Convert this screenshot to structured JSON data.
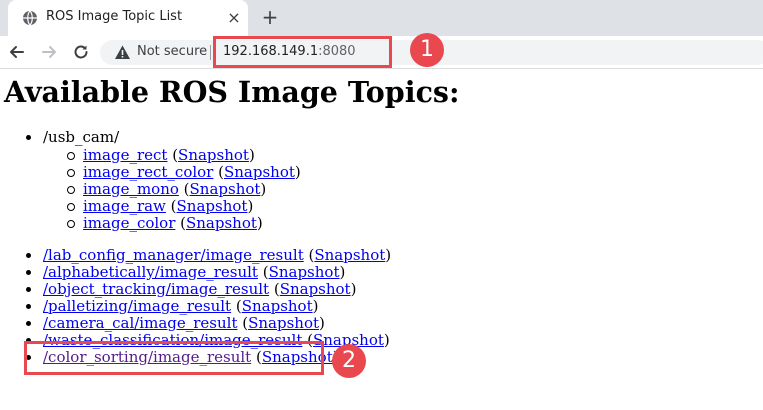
{
  "browser": {
    "tab_title": "ROS Image Topic List",
    "close_glyph": "×",
    "newtab_glyph": "+",
    "security_label": "Not secure",
    "url_host": "192.168.149.1",
    "url_port": ":8080"
  },
  "page": {
    "title": "Available ROS Image Topics:",
    "group": {
      "label": "/usb_cam/",
      "items": [
        {
          "name": "image_rect",
          "snapshot": "Snapshot"
        },
        {
          "name": "image_rect_color",
          "snapshot": "Snapshot"
        },
        {
          "name": "image_mono",
          "snapshot": "Snapshot"
        },
        {
          "name": "image_raw",
          "snapshot": "Snapshot"
        },
        {
          "name": "image_color",
          "snapshot": "Snapshot"
        }
      ]
    },
    "topics": [
      {
        "name": "/lab_config_manager/image_result",
        "snapshot": "Snapshot"
      },
      {
        "name": "/alphabetically/image_result",
        "snapshot": "Snapshot"
      },
      {
        "name": "/object_tracking/image_result",
        "snapshot": "Snapshot"
      },
      {
        "name": "/palletizing/image_result",
        "snapshot": "Snapshot"
      },
      {
        "name": "/camera_cal/image_result",
        "snapshot": "Snapshot"
      },
      {
        "name": "/waste_classification/image_result",
        "snapshot": "Snapshot"
      },
      {
        "name": "/color_sorting/image_result",
        "snapshot": "Snapshot"
      }
    ]
  },
  "annotations": {
    "callout_1": "1",
    "callout_2": "2",
    "color": "#e9484e"
  }
}
